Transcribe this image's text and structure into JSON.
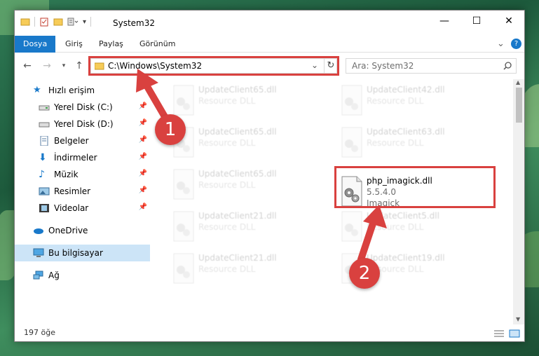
{
  "window": {
    "title": "System32",
    "minimize": "—",
    "maximize": "☐",
    "close": "✕"
  },
  "ribbon": {
    "tabs": [
      {
        "label": "Dosya",
        "active": true
      },
      {
        "label": "Giriş"
      },
      {
        "label": "Paylaş"
      },
      {
        "label": "Görünüm"
      }
    ],
    "expand": "⌄",
    "help": "?"
  },
  "address": {
    "path": "C:\\Windows\\System32",
    "dropdown": "⌄",
    "refresh": "↻"
  },
  "search": {
    "placeholder": "Ara: System32"
  },
  "sidebar": {
    "items": [
      {
        "label": "Hızlı erişim",
        "icon": "star-icon",
        "pinned": false
      },
      {
        "label": "Yerel Disk (C:)",
        "icon": "drive-icon",
        "pinned": true
      },
      {
        "label": "Yerel Disk (D:)",
        "icon": "drive-icon",
        "pinned": true
      },
      {
        "label": "Belgeler",
        "icon": "documents-icon",
        "pinned": true
      },
      {
        "label": "İndirmeler",
        "icon": "download-icon",
        "pinned": true
      },
      {
        "label": "Müzik",
        "icon": "music-icon",
        "pinned": true
      },
      {
        "label": "Resimler",
        "icon": "pictures-icon",
        "pinned": true
      },
      {
        "label": "Videolar",
        "icon": "videos-icon",
        "pinned": true
      },
      {
        "label": "OneDrive",
        "icon": "cloud-icon"
      },
      {
        "label": "Bu bilgisayar",
        "icon": "computer-icon",
        "selected": true
      },
      {
        "label": "Ağ",
        "icon": "network-icon"
      }
    ]
  },
  "files": [
    {
      "name": "UpdateClient65.dll",
      "type": "Resource DLL",
      "faded": true
    },
    {
      "name": "UpdateClient42.dll",
      "type": "Resource DLL",
      "faded": true
    },
    {
      "name": "UpdateClient65.dll",
      "type": "Resource DLL",
      "faded": true
    },
    {
      "name": "UpdateClient63.dll",
      "type": "Resource DLL",
      "faded": true
    },
    {
      "name": "UpdateClient65.dll",
      "type": "Resource DLL",
      "faded": true
    },
    {
      "name": "php_imagick.dll",
      "type": "5.5.4.0",
      "company": "Imagick",
      "faded": false
    },
    {
      "name": "UpdateClient21.dll",
      "type": "Resource DLL",
      "faded": true
    },
    {
      "name": "UpdateClient5.dll",
      "type": "Resource DLL",
      "faded": true
    },
    {
      "name": "UpdateClient21.dll",
      "type": "Resource DLL",
      "faded": true
    },
    {
      "name": "UpdateClient19.dll",
      "type": "Resource DLL",
      "faded": true
    }
  ],
  "status": {
    "count": "197 öğe"
  },
  "annotations": {
    "badge1": "1",
    "badge2": "2",
    "highlight_color": "#d9413f"
  },
  "colors": {
    "accent": "#1979ca",
    "selection": "#cce4f7"
  }
}
